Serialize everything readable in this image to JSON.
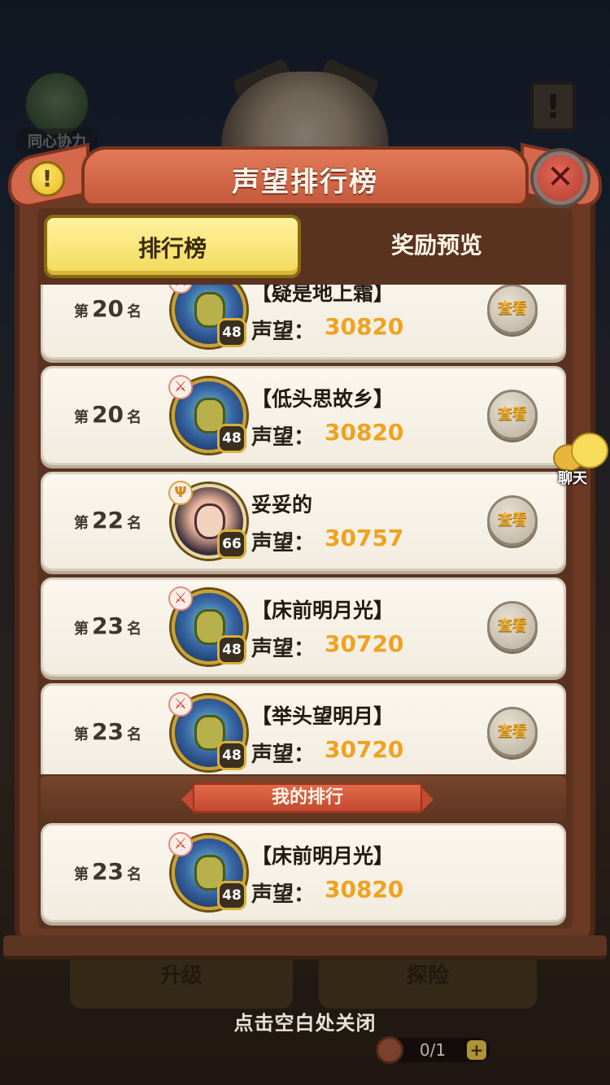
{
  "background": {
    "team_label": "同心协力",
    "scroll_icon": "!",
    "bottom_buttons": [
      "升级",
      "探险"
    ],
    "close_hint": "点击空白处关闭",
    "counter": "0/1",
    "counter_plus": "+"
  },
  "panel": {
    "title": "声望排行榜",
    "info_icon": "!",
    "close_icon": "✕"
  },
  "tabs": [
    {
      "label": "排行榜",
      "active": true
    },
    {
      "label": "奖励预览",
      "active": false
    }
  ],
  "rank_prefix": "第",
  "rank_suffix": "名",
  "rep_label": "声望：",
  "view_label": "查看",
  "rows": [
    {
      "rank": "20",
      "name": "【疑是地上霜】",
      "level": "48",
      "reputation": "30820",
      "avatar": "mecha-icon",
      "badge": "warrior-icon"
    },
    {
      "rank": "20",
      "name": "【低头思故乡】",
      "level": "48",
      "reputation": "30820",
      "avatar": "mecha-icon",
      "badge": "warrior-icon"
    },
    {
      "rank": "22",
      "name": "妥妥的",
      "level": "66",
      "reputation": "30757",
      "avatar": "girl-icon",
      "badge": "trident-icon"
    },
    {
      "rank": "23",
      "name": "【床前明月光】",
      "level": "48",
      "reputation": "30720",
      "avatar": "mecha-icon",
      "badge": "warrior-icon"
    },
    {
      "rank": "23",
      "name": "【举头望明月】",
      "level": "48",
      "reputation": "30720",
      "avatar": "mecha-icon",
      "badge": "warrior-icon"
    }
  ],
  "my_rank": {
    "header": "我的排行",
    "rank": "23",
    "name": "【床前明月光】",
    "level": "48",
    "reputation": "30820"
  },
  "chat": {
    "label": "聊天"
  },
  "colors": {
    "reputation": "#f0a21e",
    "tab_active": "#f3da5a",
    "title_banner": "#c55a3c",
    "panel": "#6b3a24"
  }
}
